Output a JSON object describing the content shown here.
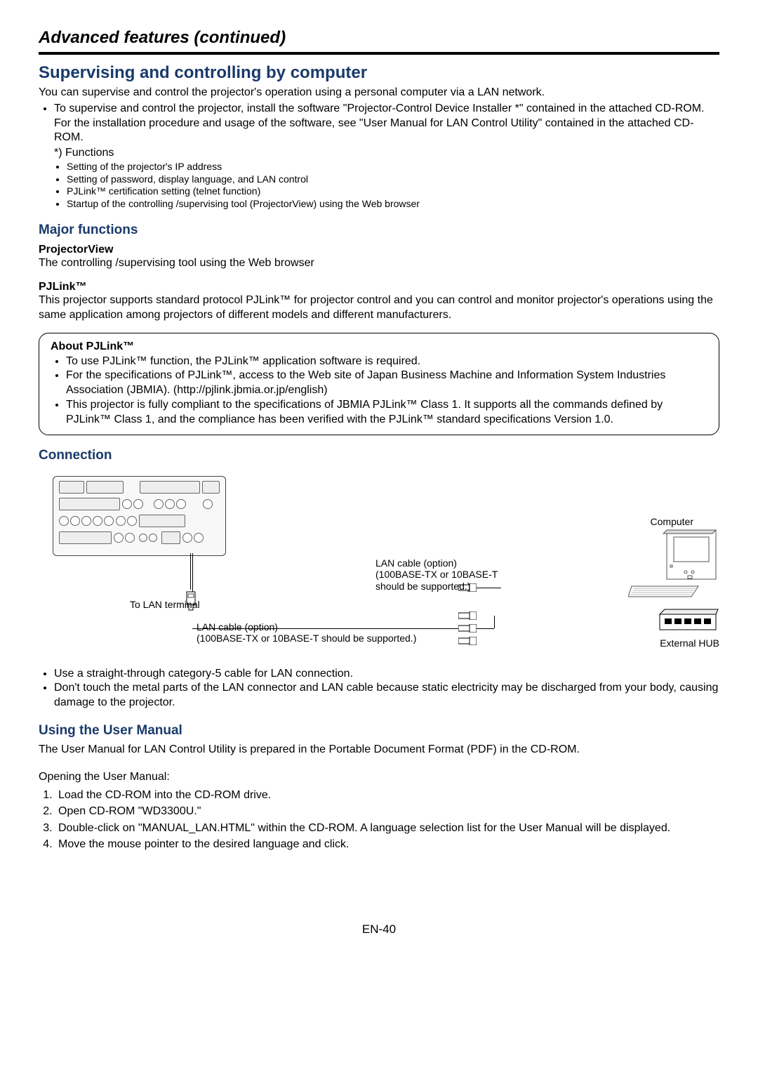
{
  "chapter_title": "Advanced features (continued)",
  "section1": {
    "heading": "Supervising and controlling by computer",
    "intro": "You can supervise and control the projector's operation using a personal computer via a LAN network.",
    "bullet1": "To supervise and control the projector, install the software \"Projector-Control Device Installer *\" contained in the attached CD-ROM. For the installation procedure and usage of the software, see \"User Manual for LAN Control Utility\" contained in the attached CD-ROM.",
    "functions_label": "*) Functions",
    "functions": [
      "Setting of the projector's IP address",
      "Setting of password, display language, and LAN control",
      "PJLink™ certification setting (telnet function)",
      "Startup of the controlling /supervising tool (ProjectorView) using the Web browser"
    ]
  },
  "major": {
    "heading": "Major functions",
    "pv_heading": "ProjectorView",
    "pv_text": "The controlling /supervising tool using the Web browser",
    "pj_heading": "PJLink™",
    "pj_text": "This projector supports standard protocol PJLink™ for projector control and you can control and monitor projector's operations using the same application among projectors of different models and different manufacturers."
  },
  "about_box": {
    "heading": "About PJLink™",
    "items": [
      "To use PJLink™ function, the PJLink™ application software is required.",
      "For the specifications of PJLink™, access to the Web site of Japan Business Machine and Information System Industries Association (JBMIA). (http://pjlink.jbmia.or.jp/english)",
      "This projector is fully compliant to the specifications of JBMIA PJLink™ Class 1. It supports all the commands defined by PJLink™ Class 1, and the compliance has been verified with the PJLink™ standard specifications Version 1.0."
    ]
  },
  "connection": {
    "heading": "Connection",
    "to_lan": "To LAN terminal",
    "cable1_l1": "LAN cable (option)",
    "cable1_l2": "(100BASE-TX or 10BASE-T should be supported.)",
    "cable2_l1": "LAN cable (option)",
    "cable2_l2": "(100BASE-TX or 10BASE-T",
    "cable2_l3": "should be supported.)",
    "computer": "Computer",
    "hub": "External HUB",
    "notes": [
      "Use a straight-through category-5 cable for LAN connection.",
      "Don't touch the metal parts of the LAN connector and LAN cable because static electricity may be discharged from your body, causing damage to the projector."
    ]
  },
  "manual": {
    "heading": "Using the User Manual",
    "intro": "The User Manual for LAN Control Utility is prepared in the Portable Document Format (PDF) in the CD-ROM.",
    "opening": "Opening the User Manual:",
    "steps": [
      "Load the CD-ROM into the CD-ROM drive.",
      "Open CD-ROM \"WD3300U.\"",
      "Double-click on \"MANUAL_LAN.HTML\" within the CD-ROM. A language selection list for the User Manual will be displayed.",
      "Move the mouse pointer to the desired language and click."
    ]
  },
  "page_number": "EN-40"
}
